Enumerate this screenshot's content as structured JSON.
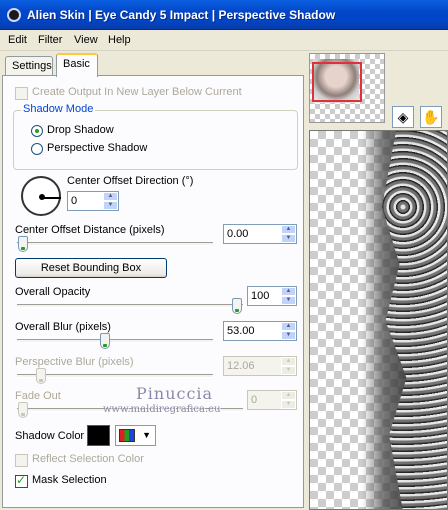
{
  "window": {
    "title": "Alien Skin  |  Eye Candy 5 Impact  |  Perspective Shadow"
  },
  "menu": [
    "Edit",
    "Filter",
    "View",
    "Help"
  ],
  "tabs": [
    {
      "label": "Settings",
      "active": false
    },
    {
      "label": "Basic",
      "active": true
    }
  ],
  "basic": {
    "create_output_label": "Create Output In New Layer Below Current",
    "create_output_checked": false,
    "shadow_mode": {
      "legend": "Shadow Mode",
      "options": [
        {
          "label": "Drop Shadow",
          "selected": true
        },
        {
          "label": "Perspective Shadow",
          "selected": false
        }
      ]
    },
    "center_offset_direction": {
      "label": "Center Offset Direction (°)",
      "value": "0"
    },
    "center_offset_distance": {
      "label": "Center Offset Distance (pixels)",
      "value": "0.00",
      "slider": 0.0
    },
    "reset_button": "Reset Bounding Box",
    "overall_opacity": {
      "label": "Overall Opacity",
      "value": "100",
      "slider": 1.0
    },
    "overall_blur": {
      "label": "Overall Blur (pixels)",
      "value": "53.00",
      "slider": 0.53
    },
    "perspective_blur": {
      "label": "Perspective Blur (pixels)",
      "value": "12.06",
      "slider": 0.12,
      "disabled": true
    },
    "fade_out": {
      "label": "Fade Out",
      "value": "0",
      "slider": 0.0,
      "disabled": true
    },
    "shadow_color": {
      "label": "Shadow Color",
      "swatch": "#000000"
    },
    "reflect_selection_label": "Reflect Selection Color",
    "reflect_selection_checked": false,
    "mask_selection_label": "Mask Selection",
    "mask_selection_checked": true
  },
  "watermark": {
    "line1": "Pinuccia",
    "line2": "www.maldiregrafica.eu"
  },
  "icons": {
    "navigator_tool": "navigator-icon",
    "hand_tool": "hand-icon"
  },
  "colors": {
    "titlebar": "#0247c9",
    "accent_green": "#21a121",
    "group_legend": "#0046d5"
  }
}
